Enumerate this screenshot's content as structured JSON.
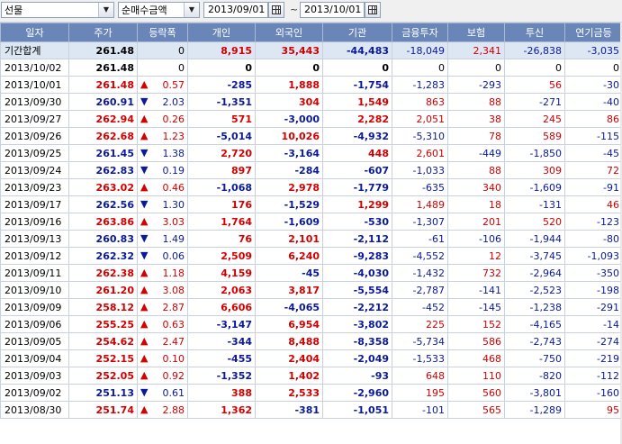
{
  "toolbar": {
    "market": "선물",
    "metric": "순매수금액",
    "date_from": "2013/09/01",
    "date_to": "2013/10/01",
    "range_sep": "~"
  },
  "colors": {
    "up": "#d40000",
    "down": "#0a1a9a",
    "header": "#6a86b8",
    "total_row": "#dde7f4"
  },
  "columns": [
    "일자",
    "주가",
    "등락폭",
    "개인",
    "외국인",
    "기관",
    "금융투자",
    "보험",
    "투신",
    "연기금등"
  ],
  "total": {
    "label": "기간합계",
    "price": "261.48",
    "change": "0",
    "indiv": "8,915",
    "foreign": "35,443",
    "inst": "-44,483",
    "fin": "-18,049",
    "ins": "2,341",
    "trust": "-26,838",
    "pension": "-3,035"
  },
  "rows": [
    {
      "date": "2013/10/02",
      "price": "261.48",
      "dir": "",
      "change": "0",
      "indiv": "0",
      "foreign": "0",
      "inst": "0",
      "fin": "0",
      "ins": "0",
      "trust": "0",
      "pension": "0"
    },
    {
      "date": "2013/10/01",
      "price": "261.48",
      "dir": "up",
      "change": "0.57",
      "indiv": "-285",
      "foreign": "1,888",
      "inst": "-1,754",
      "fin": "-1,283",
      "ins": "-293",
      "trust": "56",
      "pension": "-30"
    },
    {
      "date": "2013/09/30",
      "price": "260.91",
      "dir": "dn",
      "change": "2.03",
      "indiv": "-1,351",
      "foreign": "304",
      "inst": "1,549",
      "fin": "863",
      "ins": "88",
      "trust": "-271",
      "pension": "-40"
    },
    {
      "date": "2013/09/27",
      "price": "262.94",
      "dir": "up",
      "change": "0.26",
      "indiv": "571",
      "foreign": "-3,000",
      "inst": "2,282",
      "fin": "2,051",
      "ins": "38",
      "trust": "245",
      "pension": "86"
    },
    {
      "date": "2013/09/26",
      "price": "262.68",
      "dir": "up",
      "change": "1.23",
      "indiv": "-5,014",
      "foreign": "10,026",
      "inst": "-4,932",
      "fin": "-5,310",
      "ins": "78",
      "trust": "589",
      "pension": "-115"
    },
    {
      "date": "2013/09/25",
      "price": "261.45",
      "dir": "dn",
      "change": "1.38",
      "indiv": "2,720",
      "foreign": "-3,164",
      "inst": "448",
      "fin": "2,601",
      "ins": "-449",
      "trust": "-1,850",
      "pension": "-45"
    },
    {
      "date": "2013/09/24",
      "price": "262.83",
      "dir": "dn",
      "change": "0.19",
      "indiv": "897",
      "foreign": "-284",
      "inst": "-607",
      "fin": "-1,033",
      "ins": "88",
      "trust": "309",
      "pension": "72"
    },
    {
      "date": "2013/09/23",
      "price": "263.02",
      "dir": "up",
      "change": "0.46",
      "indiv": "-1,068",
      "foreign": "2,978",
      "inst": "-1,779",
      "fin": "-635",
      "ins": "340",
      "trust": "-1,609",
      "pension": "-91"
    },
    {
      "date": "2013/09/17",
      "price": "262.56",
      "dir": "dn",
      "change": "1.30",
      "indiv": "176",
      "foreign": "-1,529",
      "inst": "1,299",
      "fin": "1,489",
      "ins": "18",
      "trust": "-131",
      "pension": "46"
    },
    {
      "date": "2013/09/16",
      "price": "263.86",
      "dir": "up",
      "change": "3.03",
      "indiv": "1,764",
      "foreign": "-1,609",
      "inst": "-530",
      "fin": "-1,307",
      "ins": "201",
      "trust": "520",
      "pension": "-123"
    },
    {
      "date": "2013/09/13",
      "price": "260.83",
      "dir": "dn",
      "change": "1.49",
      "indiv": "76",
      "foreign": "2,101",
      "inst": "-2,112",
      "fin": "-61",
      "ins": "-106",
      "trust": "-1,944",
      "pension": "-80"
    },
    {
      "date": "2013/09/12",
      "price": "262.32",
      "dir": "dn",
      "change": "0.06",
      "indiv": "2,509",
      "foreign": "6,240",
      "inst": "-9,283",
      "fin": "-4,552",
      "ins": "12",
      "trust": "-3,745",
      "pension": "-1,093"
    },
    {
      "date": "2013/09/11",
      "price": "262.38",
      "dir": "up",
      "change": "1.18",
      "indiv": "4,159",
      "foreign": "-45",
      "inst": "-4,030",
      "fin": "-1,432",
      "ins": "732",
      "trust": "-2,964",
      "pension": "-350"
    },
    {
      "date": "2013/09/10",
      "price": "261.20",
      "dir": "up",
      "change": "3.08",
      "indiv": "2,063",
      "foreign": "3,817",
      "inst": "-5,554",
      "fin": "-2,787",
      "ins": "-141",
      "trust": "-2,523",
      "pension": "-198"
    },
    {
      "date": "2013/09/09",
      "price": "258.12",
      "dir": "up",
      "change": "2.87",
      "indiv": "6,606",
      "foreign": "-4,065",
      "inst": "-2,212",
      "fin": "-452",
      "ins": "-145",
      "trust": "-1,238",
      "pension": "-291"
    },
    {
      "date": "2013/09/06",
      "price": "255.25",
      "dir": "up",
      "change": "0.63",
      "indiv": "-3,147",
      "foreign": "6,954",
      "inst": "-3,802",
      "fin": "225",
      "ins": "152",
      "trust": "-4,165",
      "pension": "-14"
    },
    {
      "date": "2013/09/05",
      "price": "254.62",
      "dir": "up",
      "change": "2.47",
      "indiv": "-344",
      "foreign": "8,488",
      "inst": "-8,358",
      "fin": "-5,734",
      "ins": "586",
      "trust": "-2,743",
      "pension": "-274"
    },
    {
      "date": "2013/09/04",
      "price": "252.15",
      "dir": "up",
      "change": "0.10",
      "indiv": "-455",
      "foreign": "2,404",
      "inst": "-2,049",
      "fin": "-1,533",
      "ins": "468",
      "trust": "-750",
      "pension": "-219"
    },
    {
      "date": "2013/09/03",
      "price": "252.05",
      "dir": "up",
      "change": "0.92",
      "indiv": "-1,352",
      "foreign": "1,402",
      "inst": "-93",
      "fin": "648",
      "ins": "110",
      "trust": "-820",
      "pension": "-112"
    },
    {
      "date": "2013/09/02",
      "price": "251.13",
      "dir": "dn",
      "change": "0.61",
      "indiv": "388",
      "foreign": "2,533",
      "inst": "-2,960",
      "fin": "195",
      "ins": "560",
      "trust": "-3,801",
      "pension": "-160"
    },
    {
      "date": "2013/08/30",
      "price": "251.74",
      "dir": "up",
      "change": "2.88",
      "indiv": "1,362",
      "foreign": "-381",
      "inst": "-1,051",
      "fin": "-101",
      "ins": "565",
      "trust": "-1,289",
      "pension": "95"
    }
  ]
}
